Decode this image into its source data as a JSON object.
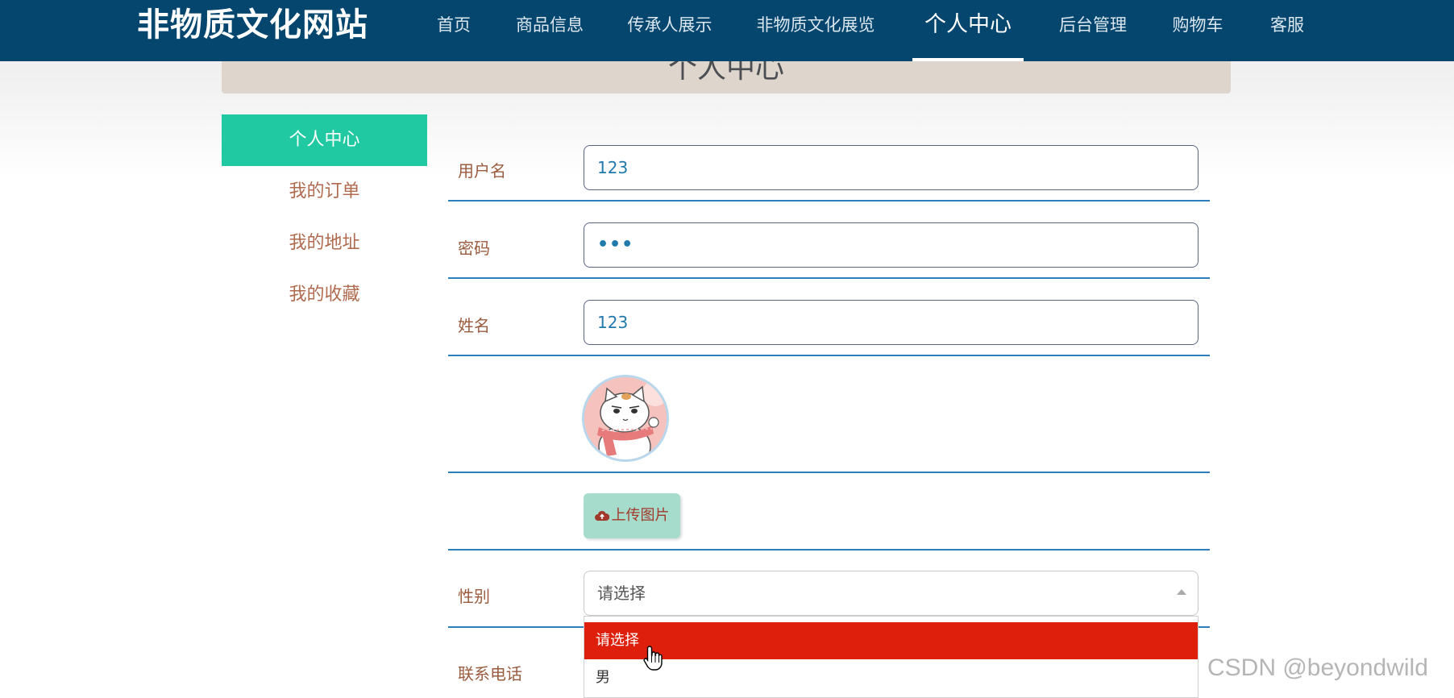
{
  "brand": "非物质文化网站",
  "nav": {
    "items": [
      {
        "label": "首页"
      },
      {
        "label": "商品信息"
      },
      {
        "label": "传承人展示"
      },
      {
        "label": "非物质文化展览"
      },
      {
        "label": "个人中心"
      },
      {
        "label": "后台管理"
      },
      {
        "label": "购物车"
      },
      {
        "label": "客服"
      }
    ],
    "active": "个人中心"
  },
  "page_title": "个人中心",
  "sidebar": {
    "items": [
      {
        "label": "个人中心"
      },
      {
        "label": "我的订单"
      },
      {
        "label": "我的地址"
      },
      {
        "label": "我的收藏"
      }
    ]
  },
  "form": {
    "username": {
      "label": "用户名",
      "value": "123"
    },
    "password": {
      "label": "密码",
      "value": "•••"
    },
    "name": {
      "label": "姓名",
      "value": "123"
    },
    "upload_label": "上传图片",
    "gender": {
      "label": "性别",
      "value": "请选择",
      "options": [
        "请选择",
        "男"
      ]
    },
    "phone": {
      "label": "联系电话"
    }
  },
  "watermark": "CSDN @beyondwild",
  "colors": {
    "nav_bg": "#04466e",
    "accent": "#20c9a1",
    "selected_option": "#de1f0b",
    "label_text": "#9a5b3e"
  }
}
